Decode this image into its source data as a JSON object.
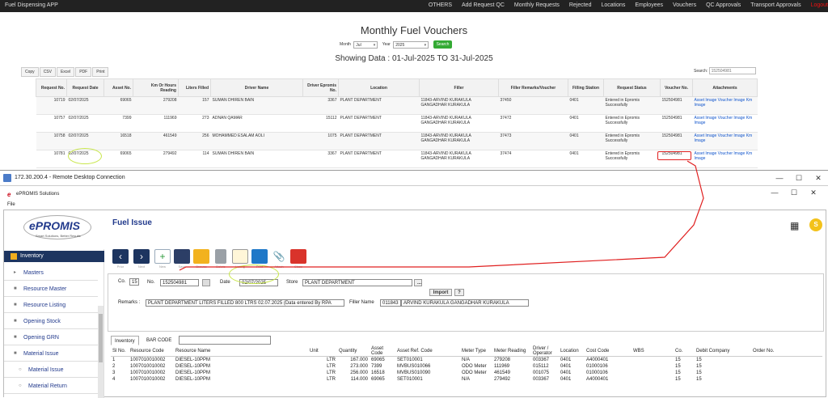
{
  "topbar": {
    "brand": "Fuel Dispensing APP",
    "nav": [
      "OTHERS",
      "Add Request QC",
      "Monthly Requests",
      "Rejected",
      "Locations",
      "Employees",
      "Vouchers",
      "QC Approvals",
      "Transport Approvals",
      "Logout"
    ]
  },
  "page_title": "Monthly Fuel Vouchers",
  "filter": {
    "month_label": "Month",
    "month_value": "Jul",
    "year_label": "Year",
    "year_value": "2025",
    "search_button": "Search"
  },
  "showing": "Showing Data : 01-Jul-2025 TO 31-Jul-2025",
  "tools": [
    "Copy",
    "CSV",
    "Excel",
    "PDF",
    "Print"
  ],
  "search": {
    "label": "Search:",
    "value": "152504981"
  },
  "vouchers": {
    "columns": [
      "Request No.",
      "Request Date",
      "Asset No.",
      "Km Or Hours Reading",
      "Liters Filled",
      "Driver Name",
      "Driver Epromis No.",
      "Location",
      "Filler",
      "Filler Remarks/Voucher",
      "Filling Station",
      "Request Status",
      "Voucher No.",
      "Attachments"
    ],
    "rows": [
      [
        "10719",
        "02/07/2025",
        "69065",
        "279208",
        "157",
        "SUMAN DHIREN BAIN",
        "3367",
        "PLANT DEPARTMENT",
        "11843-ARVIND KURAKULA GANGADHAR KURAKULA",
        "37450",
        "0401",
        "Entered in Epromis Successfully",
        "152504981",
        "Asset Image Voucher Image Km Image"
      ],
      [
        "10757",
        "02/07/2025",
        "7399",
        "111969",
        "273",
        "ADNAN QAMAR",
        "15112",
        "PLANT DEPARTMENT",
        "11843-ARVIND KURAKULA GANGADHAR KURAKULA",
        "37472",
        "0401",
        "Entered in Epromis Successfully",
        "152504981",
        "Asset Image Voucher Image Km Image"
      ],
      [
        "10758",
        "02/07/2025",
        "16518",
        "461549",
        "256",
        "MOHAMMED ESALAM AOLI",
        "1075",
        "PLANT DEPARTMENT",
        "11843-ARVIND KURAKULA GANGADHAR KURAKULA",
        "37473",
        "0401",
        "Entered in Epromis Successfully",
        "152504981",
        "Asset Image Voucher Image Km Image"
      ],
      [
        "10781",
        "02/07/2025",
        "69065",
        "279492",
        "114",
        "SUMAN DHIREN BAIN",
        "3367",
        "PLANT DEPARTMENT",
        "11843-ARVIND KURAKULA GANGADHAR KURAKULA",
        "37474",
        "0401",
        "Entered in Epromis Successfully",
        "152504981",
        "Asset Image Voucher Image Km Image"
      ]
    ]
  },
  "rdp": {
    "title": "172.30.200.4 - Remote Desktop Connection",
    "controls": [
      "—",
      "☐",
      "✕"
    ]
  },
  "epromis": {
    "window_title": "ePROMIS Solutions",
    "menu": "File",
    "logo_text": "ePROMIS",
    "logo_tagline": "Smart Solutions, Better Results",
    "module_title": "Fuel Issue",
    "avatar": "S",
    "sidebar": {
      "section": "Inventory",
      "items": [
        "Masters",
        "Resource Master",
        "Resource Listing",
        "Opening Stock",
        "Opening GRN",
        "Material Issue",
        "Material Issue",
        "Material Return"
      ]
    },
    "toolbar": [
      "Prior",
      "Next",
      "New",
      "Save",
      "Browse",
      "Delete",
      "Listing",
      "Print",
      "Attach",
      "Close"
    ],
    "form": {
      "co_label": "Co.",
      "co_value": "15",
      "no_label": "No.",
      "no_value": "152504981",
      "date_label": "Date",
      "date_value": "02/07/2025",
      "store_label": "Store",
      "store_value": "PLANT DEPARTMENT",
      "import_button": "Import",
      "help_button": "?",
      "remarks_label": "Remarks :",
      "remarks_value": "PLANT DEPARTMENT LITERS FILLED 800 LTRS 02.07.2025 (Data entered By RPA",
      "filler_label": "Filler Name",
      "filler_code": "011843",
      "filler_name": "ARVIND KURAKULA GANGADHAR KURAKULA"
    },
    "tabs": [
      "Inventory",
      "BAR CODE"
    ],
    "grid": {
      "columns": [
        "Sl No.",
        "Resource Code",
        "Resource  Name",
        "Unit",
        "Quantity",
        "Asset Code",
        "Asset Ref. Code",
        "Meter Type",
        "Meter Reading",
        "Driver / Operator",
        "Location",
        "Cost Code",
        "WBS",
        "Co.",
        "Debit Company",
        "Order No."
      ],
      "rows": [
        [
          "1",
          "1007010010002",
          "DIESEL-10PPM",
          "LTR",
          "167.000",
          "69065",
          "SET010001",
          "N/A",
          "279208",
          "003367",
          "0401",
          "A4000401",
          "",
          "15",
          "15",
          ""
        ],
        [
          "2",
          "1007010010002",
          "DIESEL-10PPM",
          "LTR",
          "273.000",
          "7399",
          "MVBUS010066",
          "ODO Meter",
          "111969",
          "015112",
          "0401",
          "01000106",
          "",
          "15",
          "15",
          ""
        ],
        [
          "3",
          "1007010010002",
          "DIESEL-10PPM",
          "LTR",
          "256.000",
          "16518",
          "MVBUS010090",
          "ODO Meter",
          "461549",
          "001075",
          "0401",
          "01000106",
          "",
          "15",
          "15",
          ""
        ],
        [
          "4",
          "1007010010002",
          "DIESEL-10PPM",
          "LTR",
          "114.000",
          "69065",
          "SET010001",
          "N/A",
          "279492",
          "003367",
          "0401",
          "A4000401",
          "",
          "15",
          "15",
          ""
        ]
      ]
    }
  },
  "colors": {
    "nav_bg": "#222222",
    "sidebar_active": "#1d3560",
    "title_blue": "#223a8c",
    "annotation_red": "#e02020",
    "annotation_green": "#c8e64a"
  }
}
